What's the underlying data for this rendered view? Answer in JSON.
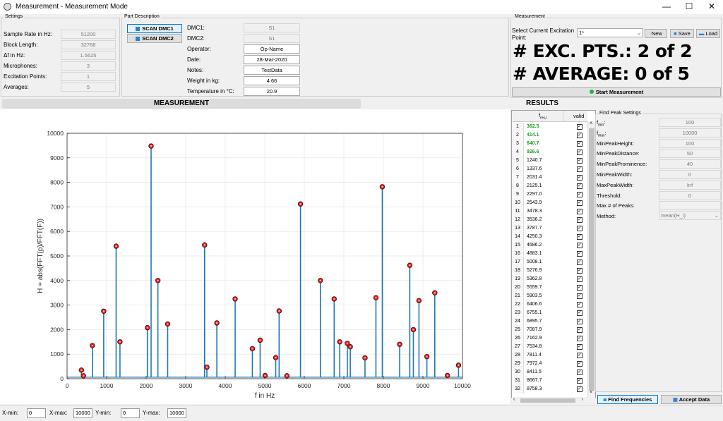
{
  "window": {
    "title": "Measurement - Measurement Mode",
    "minimize": "—",
    "maximize": "☐",
    "close": "✕"
  },
  "settings": {
    "group_label": "Settings",
    "rows": [
      {
        "label": "Sample Rate in Hz:",
        "value": "51200"
      },
      {
        "label": "Block Length:",
        "value": "32768"
      },
      {
        "label": "Δf in Hz:",
        "value": "1.5625"
      },
      {
        "label": "Microphones:",
        "value": "3"
      },
      {
        "label": "Excitation Points:",
        "value": "1"
      },
      {
        "label": "Averages:",
        "value": "5"
      }
    ]
  },
  "part": {
    "group_label": "Part Description",
    "scan_dmc1": "SCAN DMC1",
    "scan_dmc2": "SCAN DMC2",
    "rows": [
      {
        "label": "DMC1:",
        "value": "S1",
        "readonly": true
      },
      {
        "label": "DMC2:",
        "value": "S1",
        "readonly": true
      },
      {
        "label": "Operator:",
        "value": "Op-Name",
        "readonly": false
      },
      {
        "label": "Date:",
        "value": "28-Mar-2020",
        "readonly": false
      },
      {
        "label": "Notes:",
        "value": "TestData",
        "readonly": false
      },
      {
        "label": "Weight in kg:",
        "value": "4.66",
        "readonly": false
      },
      {
        "label": "Temperature in °C:",
        "value": "20.9",
        "readonly": false
      }
    ]
  },
  "measurement": {
    "group_label": "Measurement",
    "select_label_1": "Select Current Excitation",
    "select_label_2": "Point:",
    "select_value": "1*",
    "new_label": "New",
    "save_label": "Save",
    "load_label": "Load",
    "exc_text": "# EXC. PTS.: 2 of 2",
    "avg_text": "# AVERAGE: 0 of 5",
    "start_label": "Start Measurement",
    "start_dot_color": "#22b14c"
  },
  "headers": {
    "measurement": "MEASUREMENT",
    "results": "RESULTS"
  },
  "chart_data": {
    "type": "line",
    "title": "",
    "xlabel": "f in Hz",
    "ylabel": "H = abs(FFT(p)/FFT(F))",
    "xlim": [
      0,
      10000
    ],
    "ylim": [
      0,
      10000
    ],
    "xticks": [
      0,
      1000,
      2000,
      3000,
      4000,
      5000,
      6000,
      7000,
      8000,
      9000,
      10000
    ],
    "yticks": [
      0,
      1000,
      2000,
      3000,
      4000,
      5000,
      6000,
      7000,
      8000,
      9000,
      10000
    ],
    "grid": true,
    "line_color": "#1f77b4",
    "marker_color": "#d62728",
    "peaks": [
      {
        "x": 362.5,
        "y": 350
      },
      {
        "x": 414.1,
        "y": 120
      },
      {
        "x": 640.7,
        "y": 1350
      },
      {
        "x": 926.6,
        "y": 2750
      },
      {
        "x": 1240.7,
        "y": 5400
      },
      {
        "x": 1337.6,
        "y": 1500
      },
      {
        "x": 2031.4,
        "y": 2080
      },
      {
        "x": 2125.1,
        "y": 9480
      },
      {
        "x": 2297.0,
        "y": 4000
      },
      {
        "x": 2543.9,
        "y": 2230
      },
      {
        "x": 3478.3,
        "y": 5450
      },
      {
        "x": 3536.2,
        "y": 470
      },
      {
        "x": 3787.7,
        "y": 2270
      },
      {
        "x": 4250.3,
        "y": 3250
      },
      {
        "x": 4686.2,
        "y": 1220
      },
      {
        "x": 4883.1,
        "y": 1570
      },
      {
        "x": 5008.1,
        "y": 130
      },
      {
        "x": 5276.9,
        "y": 860
      },
      {
        "x": 5362.8,
        "y": 2760
      },
      {
        "x": 5559.7,
        "y": 120
      },
      {
        "x": 5903.5,
        "y": 7120
      },
      {
        "x": 6406.6,
        "y": 4000
      },
      {
        "x": 6755.1,
        "y": 3250
      },
      {
        "x": 6895.7,
        "y": 1500
      },
      {
        "x": 7087.9,
        "y": 1440
      },
      {
        "x": 7162.9,
        "y": 1300
      },
      {
        "x": 7534.8,
        "y": 850
      },
      {
        "x": 7811.4,
        "y": 3300
      },
      {
        "x": 7972.4,
        "y": 7820
      },
      {
        "x": 8411.5,
        "y": 1400
      },
      {
        "x": 8667.7,
        "y": 4620
      },
      {
        "x": 8758.3,
        "y": 2000
      },
      {
        "x": 8900.0,
        "y": 3180
      },
      {
        "x": 9100.0,
        "y": 900
      },
      {
        "x": 9300.0,
        "y": 3500
      },
      {
        "x": 9620.0,
        "y": 130
      },
      {
        "x": 9900.0,
        "y": 550
      }
    ]
  },
  "results": {
    "col_f": "f",
    "col_f_sub": "res,i",
    "col_valid": "valid",
    "check_mark": "✓",
    "rows": [
      {
        "n": "1",
        "f": "362.5",
        "green": true
      },
      {
        "n": "2",
        "f": "414.1",
        "green": true
      },
      {
        "n": "3",
        "f": "640.7",
        "green": true
      },
      {
        "n": "4",
        "f": "926.6",
        "green": true
      },
      {
        "n": "5",
        "f": "1240.7",
        "green": false
      },
      {
        "n": "6",
        "f": "1337.6",
        "green": false
      },
      {
        "n": "7",
        "f": "2031.4",
        "green": false
      },
      {
        "n": "8",
        "f": "2125.1",
        "green": false
      },
      {
        "n": "9",
        "f": "2297.0",
        "green": false
      },
      {
        "n": "10",
        "f": "2543.9",
        "green": false
      },
      {
        "n": "11",
        "f": "3478.3",
        "green": false
      },
      {
        "n": "12",
        "f": "3536.2",
        "green": false
      },
      {
        "n": "13",
        "f": "3787.7",
        "green": false
      },
      {
        "n": "14",
        "f": "4250.3",
        "green": false
      },
      {
        "n": "15",
        "f": "4686.2",
        "green": false
      },
      {
        "n": "16",
        "f": "4883.1",
        "green": false
      },
      {
        "n": "17",
        "f": "5008.1",
        "green": false
      },
      {
        "n": "18",
        "f": "5276.9",
        "green": false
      },
      {
        "n": "19",
        "f": "5362.8",
        "green": false
      },
      {
        "n": "20",
        "f": "5559.7",
        "green": false
      },
      {
        "n": "21",
        "f": "5903.5",
        "green": false
      },
      {
        "n": "22",
        "f": "6406.6",
        "green": false
      },
      {
        "n": "23",
        "f": "6755.1",
        "green": false
      },
      {
        "n": "24",
        "f": "6895.7",
        "green": false
      },
      {
        "n": "25",
        "f": "7087.9",
        "green": false
      },
      {
        "n": "26",
        "f": "7162.9",
        "green": false
      },
      {
        "n": "27",
        "f": "7534.8",
        "green": false
      },
      {
        "n": "28",
        "f": "7811.4",
        "green": false
      },
      {
        "n": "29",
        "f": "7972.4",
        "green": false
      },
      {
        "n": "30",
        "f": "8411.5",
        "green": false
      },
      {
        "n": "31",
        "f": "8667.7",
        "green": false
      },
      {
        "n": "32",
        "f": "8758.3",
        "green": false
      }
    ]
  },
  "find_peak": {
    "group_label": "Find Peak Settings",
    "rows": [
      {
        "label": "f",
        "sub": "min",
        "suffix": ":",
        "value": "100"
      },
      {
        "label": "f",
        "sub": "max",
        "suffix": ":",
        "value": "10000"
      },
      {
        "label": "MinPeakHeight:",
        "sub": "",
        "suffix": "",
        "value": "100"
      },
      {
        "label": "MinPeakDistance:",
        "sub": "",
        "suffix": "",
        "value": "50"
      },
      {
        "label": "MinPeakProminence:",
        "sub": "",
        "suffix": "",
        "value": "40"
      },
      {
        "label": "MinPeakWidth:",
        "sub": "",
        "suffix": "",
        "value": "0"
      },
      {
        "label": "MaxPeakWidth:",
        "sub": "",
        "suffix": "",
        "value": "Inf"
      },
      {
        "label": "Threshold:",
        "sub": "",
        "suffix": "",
        "value": "0"
      },
      {
        "label": "Max # of Peaks:",
        "sub": "",
        "suffix": "",
        "value": ""
      }
    ],
    "method_label": "Method:",
    "method_value": "mean(H_i)",
    "find_freq_label": "Find Frequencies",
    "accept_label": "Accept Data"
  },
  "axes_limits": {
    "xmin_label": "X-min:",
    "xmin": "0",
    "xmax_label": "X-max:",
    "xmax": "10000",
    "ymin_label": "Y-min:",
    "ymin": "0",
    "ymax_label": "Y-max:",
    "ymax": "10000"
  }
}
